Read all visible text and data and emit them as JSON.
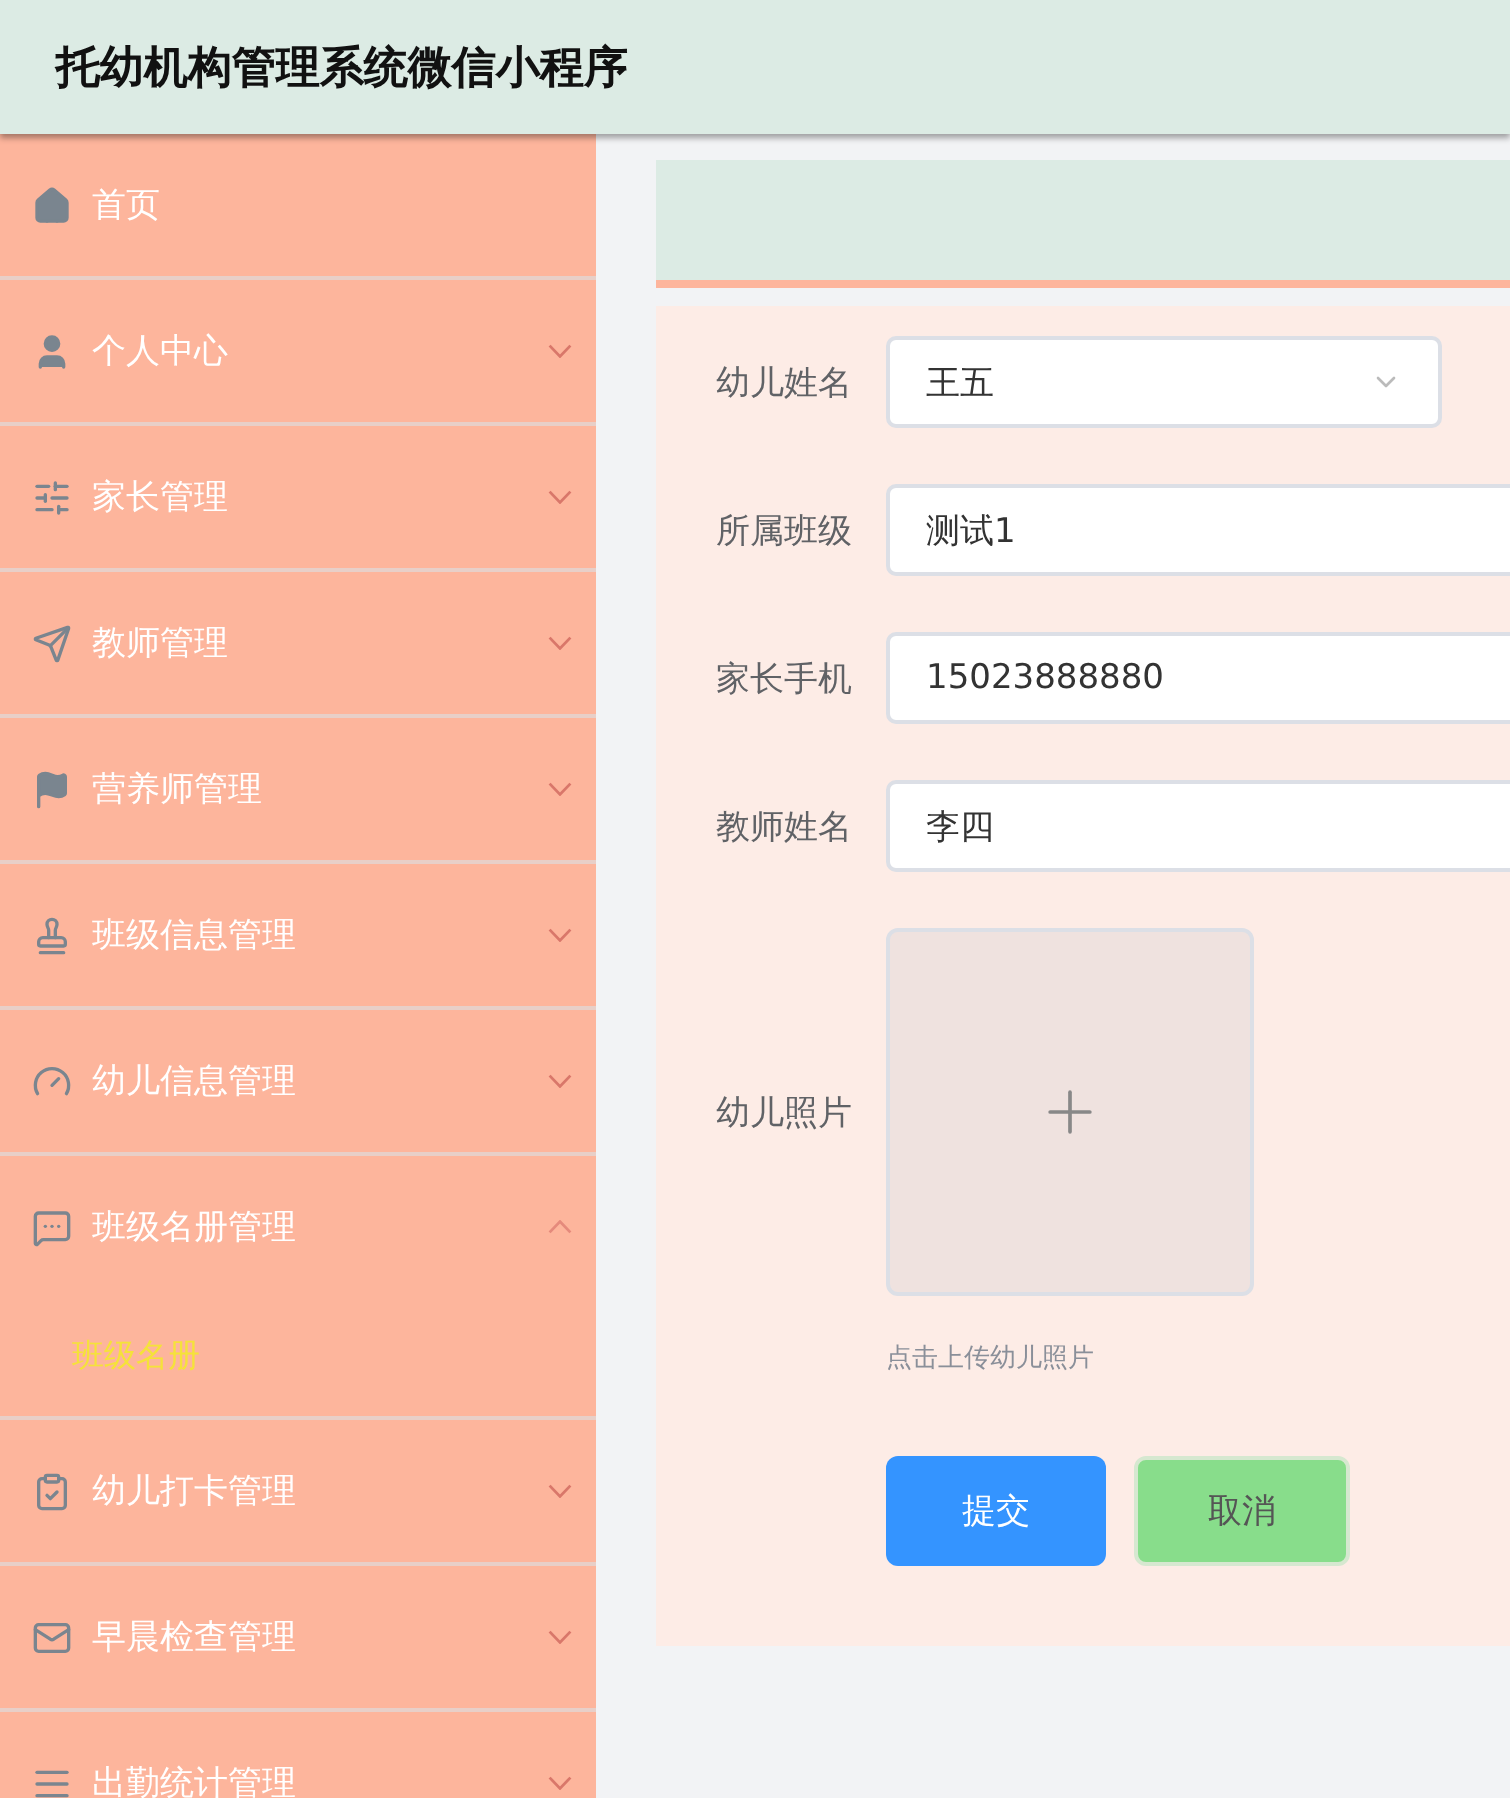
{
  "header": {
    "title": "托幼机构管理系统微信小程序"
  },
  "sidebar": {
    "items": [
      {
        "label": "首页"
      },
      {
        "label": "个人中心",
        "expanded": false
      },
      {
        "label": "家长管理",
        "expanded": false
      },
      {
        "label": "教师管理",
        "expanded": false
      },
      {
        "label": "营养师管理",
        "expanded": false
      },
      {
        "label": "班级信息管理",
        "expanded": false
      },
      {
        "label": "幼儿信息管理",
        "expanded": false
      },
      {
        "label": "班级名册管理",
        "expanded": true,
        "children": [
          {
            "label": "班级名册",
            "selected": true
          }
        ]
      },
      {
        "label": "幼儿打卡管理",
        "expanded": false
      },
      {
        "label": "早晨检查管理",
        "expanded": false
      },
      {
        "label": "出勤统计管理",
        "expanded": false
      }
    ]
  },
  "form": {
    "fields": [
      {
        "kind": "select",
        "label": "幼儿姓名",
        "value": "王五"
      },
      {
        "kind": "input",
        "label": "所属班级",
        "value": "测试1"
      },
      {
        "kind": "input",
        "label": "家长手机",
        "value": "15023888880"
      },
      {
        "kind": "input",
        "label": "教师姓名",
        "value": "李四"
      },
      {
        "kind": "upload",
        "label": "幼儿照片",
        "hint": "点击上传幼儿照片"
      }
    ],
    "buttons": [
      {
        "label": "提交",
        "kind": "primary"
      },
      {
        "label": "取消",
        "kind": "secondary"
      }
    ]
  }
}
